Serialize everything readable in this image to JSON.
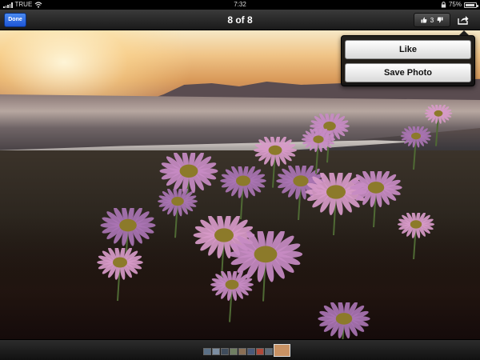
{
  "status_bar": {
    "carrier": "TRUE",
    "time": "7:32",
    "battery_percent": "75%",
    "battery_level": 0.75,
    "icons": [
      "signal-icon",
      "wifi-icon",
      "lock-icon",
      "battery-icon"
    ]
  },
  "toolbar": {
    "done_label": "Done",
    "title": "8 of 8",
    "like_count": "3",
    "icons": [
      "thumbs-up-icon",
      "thumbs-down-icon",
      "share-icon"
    ]
  },
  "share_menu": {
    "like_label": "Like",
    "save_photo_label": "Save Photo"
  },
  "photo": {
    "icon": "photo-beach-sunset-flowers"
  },
  "filmstrip": {
    "thumbnail_colors": [
      "#5a6f86",
      "#7c8ea2",
      "#3e4c5c",
      "#6f7f62",
      "#8a6f55",
      "#4a5a7a",
      "#b04a3a",
      "#5e6c7a"
    ],
    "current_index": 8,
    "current_color": "#c99264"
  },
  "colors": {
    "done_button": "#1d55d6",
    "toolbar": "#2a2a2a"
  }
}
